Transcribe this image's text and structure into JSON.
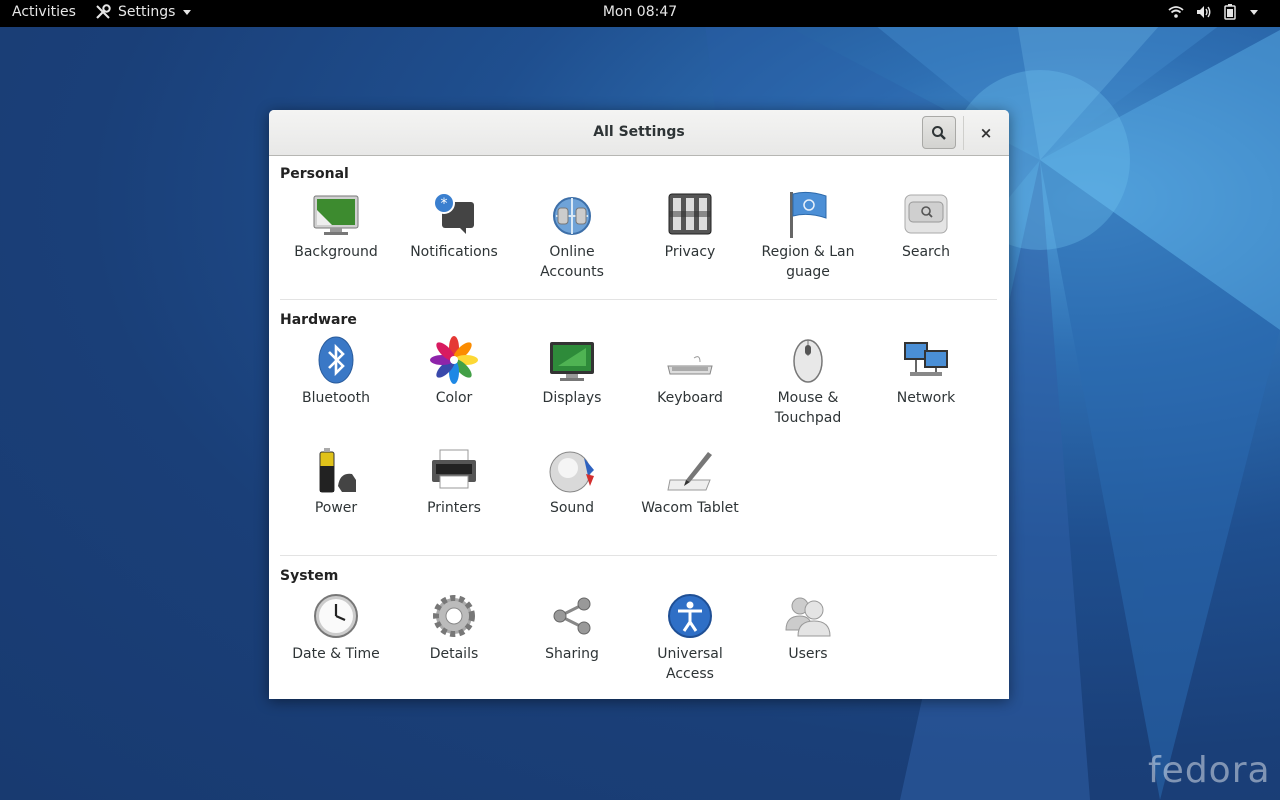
{
  "topbar": {
    "activities": "Activities",
    "app_name": "Settings",
    "clock": "Mon 08:47",
    "tray_icons": [
      "wifi-icon",
      "volume-icon",
      "battery-icon",
      "chevron-down-icon"
    ]
  },
  "window": {
    "title": "All Settings",
    "search_icon": "search-icon",
    "close_label": "×"
  },
  "sections": {
    "personal": {
      "title": "Personal",
      "items": [
        "Background",
        "Notifications",
        "Online\nAccounts",
        "Privacy",
        "Region & Lan\nguage",
        "Search"
      ]
    },
    "hardware": {
      "title": "Hardware",
      "items": [
        "Bluetooth",
        "Color",
        "Displays",
        "Keyboard",
        "Mouse &\nTouchpad",
        "Network",
        "Power",
        "Printers",
        "Sound",
        "Wacom Tablet"
      ]
    },
    "system": {
      "title": "System",
      "items": [
        "Date & Time",
        "Details",
        "Sharing",
        "Universal\nAccess",
        "Users"
      ]
    }
  },
  "branding": {
    "logo": "fedora"
  }
}
